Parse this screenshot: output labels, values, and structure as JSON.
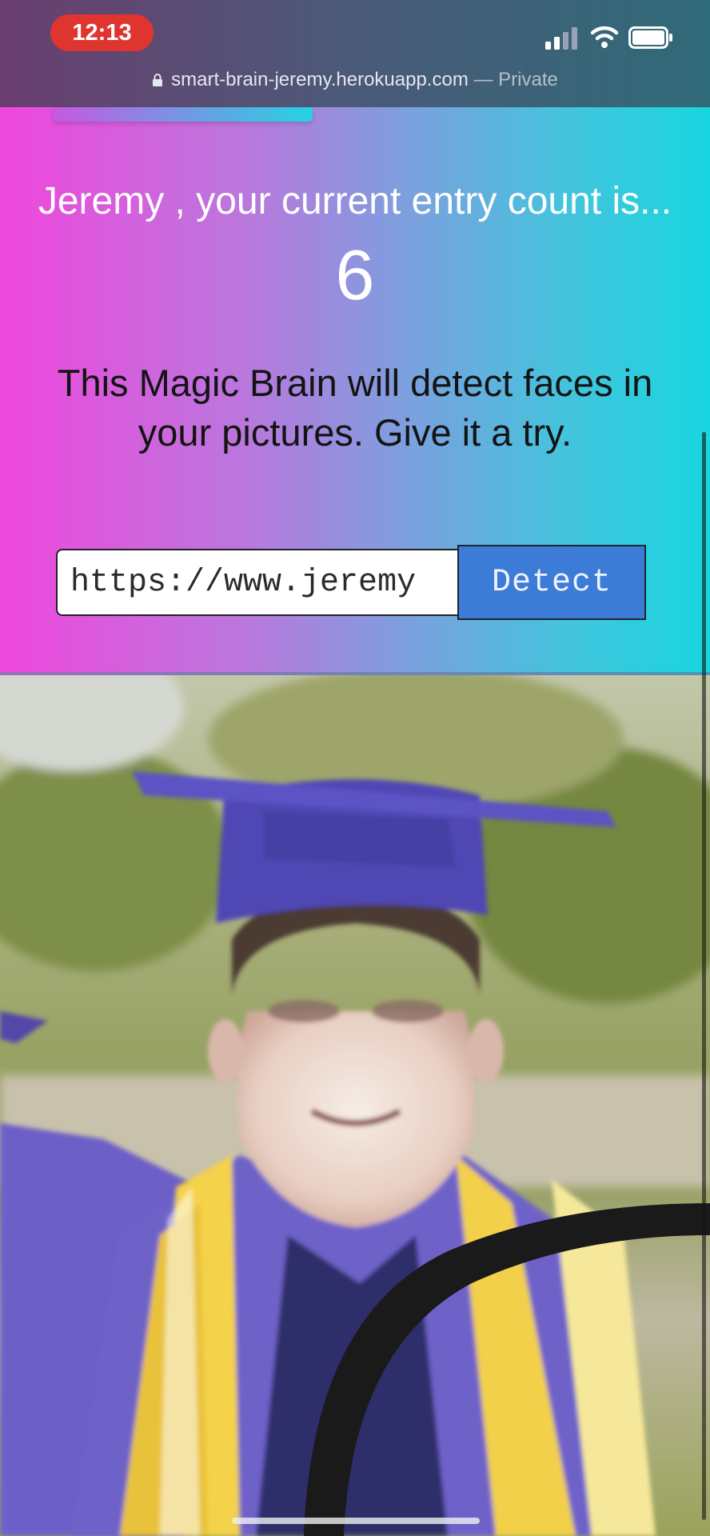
{
  "status_bar": {
    "time": "12:13",
    "icons": [
      "cellular-signal-icon",
      "wifi-icon",
      "battery-icon"
    ]
  },
  "browser": {
    "url": "smart-brain-jeremy.herokuapp.com",
    "mode": "— Private",
    "icon": "lock-icon"
  },
  "app": {
    "rank_message": "Jeremy , your current entry count is...",
    "entry_count": "6",
    "intro": "This Magic Brain will detect faces in your pictures. Give it a try.",
    "image_url_value": "https://www.jeremy",
    "detect_label": "Detect"
  },
  "colors": {
    "gradient_left": "#f047dd",
    "gradient_right": "#18d6e0",
    "button": "#3c7bd6",
    "status_time": "#e0342f"
  }
}
